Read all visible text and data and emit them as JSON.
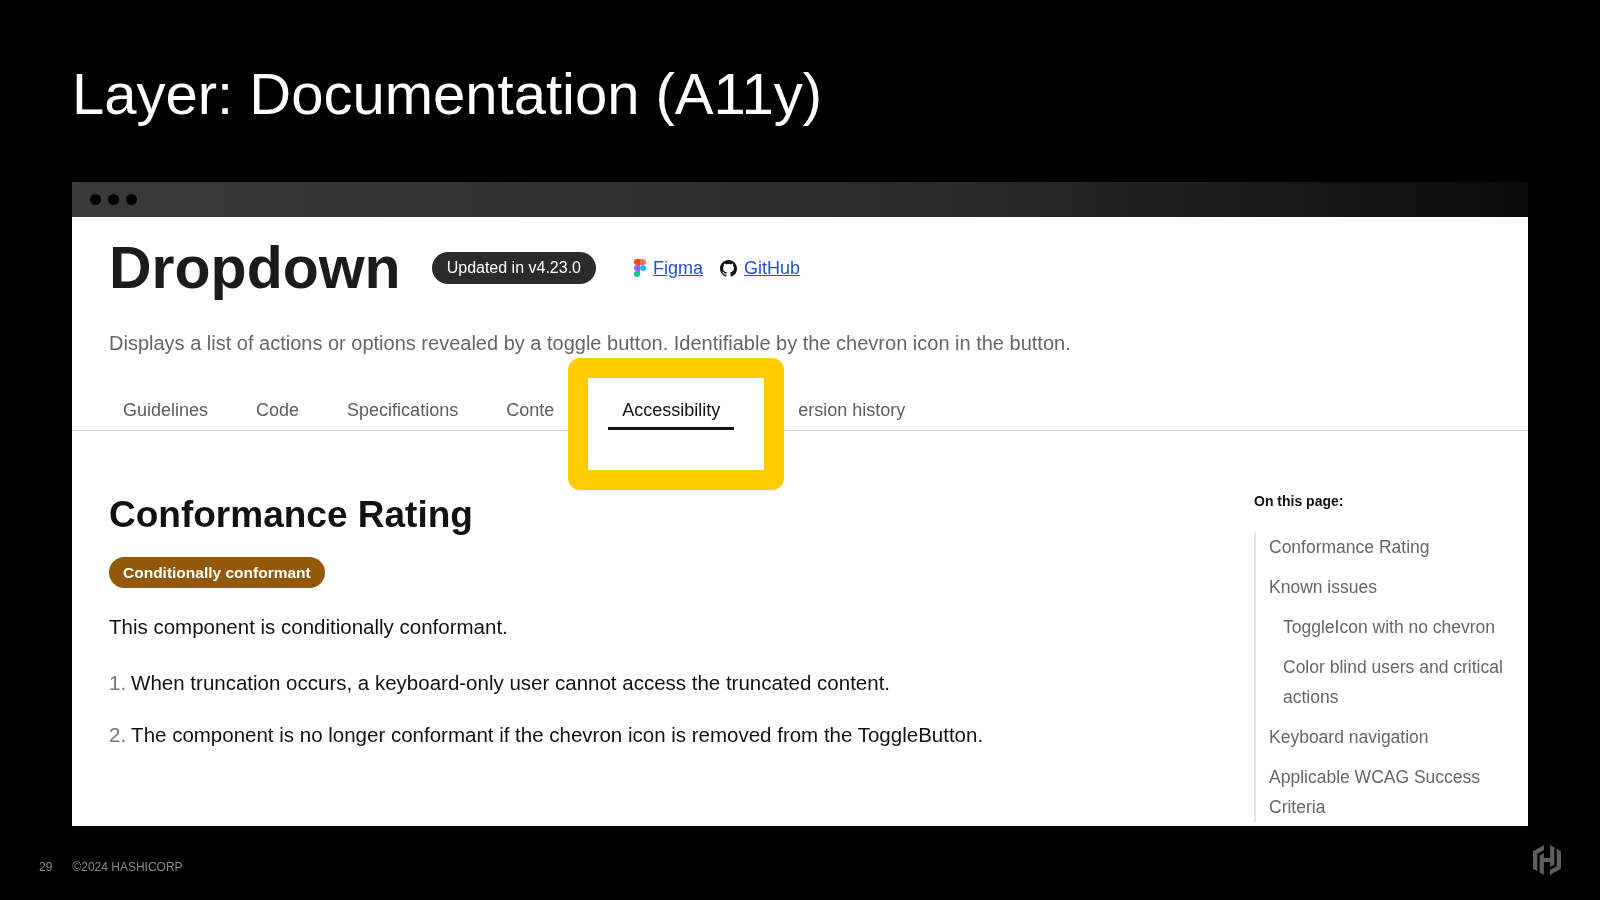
{
  "slide": {
    "title": "Layer: Documentation (A11y)"
  },
  "browser": {
    "page": {
      "title": "Dropdown",
      "version_badge": "Updated in v4.23.0",
      "links": [
        {
          "kind": "figma",
          "label": "Figma"
        },
        {
          "kind": "github",
          "label": "GitHub"
        }
      ],
      "description": "Displays a list of actions or options revealed by a toggle button. Identifiable by the chevron icon in the button.",
      "tabs": [
        {
          "label": "Guidelines",
          "selected": false,
          "highlighted": false
        },
        {
          "label": "Code",
          "selected": false,
          "highlighted": false
        },
        {
          "label": "Specifications",
          "selected": false,
          "highlighted": false
        },
        {
          "label": "Conte",
          "selected": false,
          "highlighted": false
        },
        {
          "label": "Accessibility",
          "selected": true,
          "highlighted": true
        },
        {
          "label": "ersion history",
          "selected": false,
          "highlighted": false
        }
      ],
      "article": {
        "heading": "Conformance Rating",
        "status_badge": "Conditionally conformant",
        "intro": "This component is conditionally conformant.",
        "items": [
          {
            "number": "1.",
            "text": "When truncation occurs, a keyboard-only user cannot access the truncated content."
          },
          {
            "number": "2.",
            "text": "The component is no longer conformant if the chevron icon is removed from the ToggleButton."
          }
        ]
      },
      "toc": {
        "title": "On this page:",
        "items": [
          {
            "label": "Conformance Rating"
          },
          {
            "label": "Known issues",
            "children": [
              {
                "label": "ToggleIcon with no chevron"
              },
              {
                "label": "Color blind users and critical actions"
              }
            ]
          },
          {
            "label": "Keyboard navigation"
          },
          {
            "label": "Applicable WCAG Success Criteria"
          }
        ]
      }
    }
  },
  "footer": {
    "page_number": "29",
    "copyright": "©2024 HASHICORP"
  }
}
